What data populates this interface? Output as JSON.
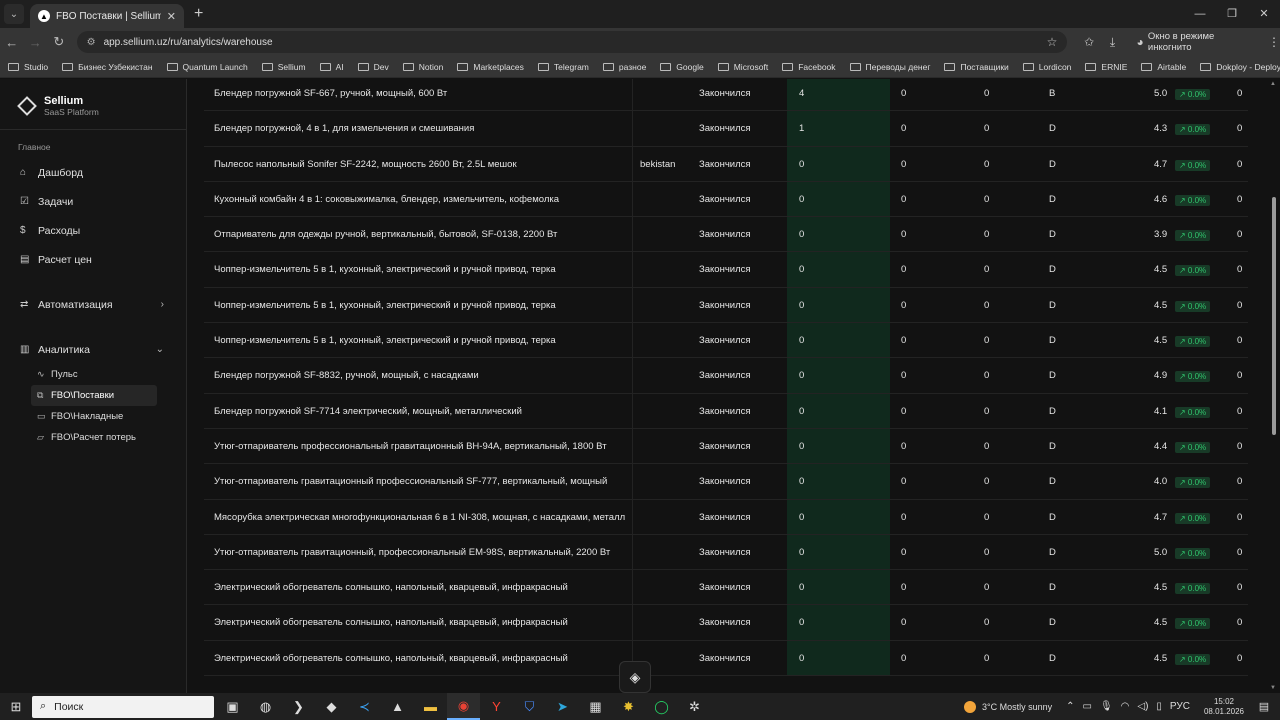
{
  "browser": {
    "tab_title": "FBO Поставки | Sellium Analytic",
    "url": "app.sellium.uz/ru/analytics/warehouse",
    "incognito_label": "Окно в режиме инкогнито",
    "bookmarks": [
      "Studio",
      "Бизнес Узбекистан",
      "Quantum Launch",
      "Sellium",
      "AI",
      "Dev",
      "Notion",
      "Marketplaces",
      "Telegram",
      "разное",
      "Google",
      "Microsoft",
      "Facebook",
      "Переводы денег",
      "Поставщики",
      "Lordicon",
      "ERNIE",
      "Airtable",
      "Dokploy - Deploy y..."
    ]
  },
  "sidebar": {
    "brand_name": "Sellium",
    "brand_sub": "SaaS Platform",
    "section_main": "Главное",
    "items": [
      "Дашборд",
      "Задачи",
      "Расходы",
      "Расчет цен"
    ],
    "automation": "Автоматизация",
    "analytics": "Аналитика",
    "sub_items": [
      "Пульс",
      "FBO\\Поставки",
      "FBO\\Накладные",
      "FBO\\Расчет потерь"
    ]
  },
  "table": {
    "rows": [
      {
        "name": "Блендер погружной SF-667, ручной, мощный, 600 Вт",
        "region": "",
        "status": "Закончился",
        "qty": "4",
        "a": "0",
        "b": "0",
        "abc": "B",
        "rating": "5.0",
        "change": "↗ 0.0%",
        "last": "0"
      },
      {
        "name": "Блендер погружной, 4 в 1, для измельчения и смешивания",
        "region": "",
        "status": "Закончился",
        "qty": "1",
        "a": "0",
        "b": "0",
        "abc": "D",
        "rating": "4.3",
        "change": "↗ 0.0%",
        "last": "0"
      },
      {
        "name": "Пылесос напольный Sonifer SF-2242, мощность 2600 Вт, 2.5L мешок",
        "region": "bekistan",
        "status": "Закончился",
        "qty": "0",
        "a": "0",
        "b": "0",
        "abc": "D",
        "rating": "4.7",
        "change": "↗ 0.0%",
        "last": "0"
      },
      {
        "name": "Кухонный комбайн 4 в 1: соковыжималка, блендер, измельчитель, кофемолка",
        "region": "",
        "status": "Закончился",
        "qty": "0",
        "a": "0",
        "b": "0",
        "abc": "D",
        "rating": "4.6",
        "change": "↗ 0.0%",
        "last": "0"
      },
      {
        "name": "Отпариватель для одежды ручной, вертикальный, бытовой, SF-0138, 2200 Вт",
        "region": "",
        "status": "Закончился",
        "qty": "0",
        "a": "0",
        "b": "0",
        "abc": "D",
        "rating": "3.9",
        "change": "↗ 0.0%",
        "last": "0"
      },
      {
        "name": "Чоппер-измельчитель 5 в 1, кухонный, электрический и ручной привод, терка",
        "region": "",
        "status": "Закончился",
        "qty": "0",
        "a": "0",
        "b": "0",
        "abc": "D",
        "rating": "4.5",
        "change": "↗ 0.0%",
        "last": "0"
      },
      {
        "name": "Чоппер-измельчитель 5 в 1, кухонный, электрический и ручной привод, терка",
        "region": "",
        "status": "Закончился",
        "qty": "0",
        "a": "0",
        "b": "0",
        "abc": "D",
        "rating": "4.5",
        "change": "↗ 0.0%",
        "last": "0"
      },
      {
        "name": "Чоппер-измельчитель 5 в 1, кухонный, электрический и ручной привод, терка",
        "region": "",
        "status": "Закончился",
        "qty": "0",
        "a": "0",
        "b": "0",
        "abc": "D",
        "rating": "4.5",
        "change": "↗ 0.0%",
        "last": "0"
      },
      {
        "name": "Блендер погружной SF-8832, ручной, мощный, с насадками",
        "region": "",
        "status": "Закончился",
        "qty": "0",
        "a": "0",
        "b": "0",
        "abc": "D",
        "rating": "4.9",
        "change": "↗ 0.0%",
        "last": "0"
      },
      {
        "name": "Блендер погружной SF-7714 электрический, мощный, металлический",
        "region": "",
        "status": "Закончился",
        "qty": "0",
        "a": "0",
        "b": "0",
        "abc": "D",
        "rating": "4.1",
        "change": "↗ 0.0%",
        "last": "0"
      },
      {
        "name": "Утюг-отпариватель профессиональный гравитационный BH-94A, вертикальный, 1800 Вт",
        "region": "",
        "status": "Закончился",
        "qty": "0",
        "a": "0",
        "b": "0",
        "abc": "D",
        "rating": "4.4",
        "change": "↗ 0.0%",
        "last": "0"
      },
      {
        "name": "Утюг-отпариватель гравитационный профессиональный SF-777, вертикальный, мощный",
        "region": "",
        "status": "Закончился",
        "qty": "0",
        "a": "0",
        "b": "0",
        "abc": "D",
        "rating": "4.0",
        "change": "↗ 0.0%",
        "last": "0"
      },
      {
        "name": "Мясорубка электрическая многофункциональная 6 в 1 NI-308, мощная, с насадками, металл",
        "region": "",
        "status": "Закончился",
        "qty": "0",
        "a": "0",
        "b": "0",
        "abc": "D",
        "rating": "4.7",
        "change": "↗ 0.0%",
        "last": "0"
      },
      {
        "name": "Утюг-отпариватель гравитационный, профессиональный EM-98S, вертикальный, 2200 Вт",
        "region": "",
        "status": "Закончился",
        "qty": "0",
        "a": "0",
        "b": "0",
        "abc": "D",
        "rating": "5.0",
        "change": "↗ 0.0%",
        "last": "0"
      },
      {
        "name": "Электрический обогреватель солнышко, напольный, кварцевый, инфракрасный",
        "region": "",
        "status": "Закончился",
        "qty": "0",
        "a": "0",
        "b": "0",
        "abc": "D",
        "rating": "4.5",
        "change": "↗ 0.0%",
        "last": "0"
      },
      {
        "name": "Электрический обогреватель солнышко, напольный, кварцевый, инфракрасный",
        "region": "",
        "status": "Закончился",
        "qty": "0",
        "a": "0",
        "b": "0",
        "abc": "D",
        "rating": "4.5",
        "change": "↗ 0.0%",
        "last": "0"
      },
      {
        "name": "Электрический обогреватель солнышко, напольный, кварцевый, инфракрасный",
        "region": "",
        "status": "Закончился",
        "qty": "0",
        "a": "0",
        "b": "0",
        "abc": "D",
        "rating": "4.5",
        "change": "↗ 0.0%",
        "last": "0"
      }
    ]
  },
  "taskbar": {
    "search_placeholder": "Поиск",
    "weather": "3°C  Mostly sunny",
    "lang": "РУС",
    "time": "15:02",
    "date": "08.01.2026"
  },
  "colors": {
    "accent_green": "#30c36c",
    "highlight_col": "#10291d"
  }
}
